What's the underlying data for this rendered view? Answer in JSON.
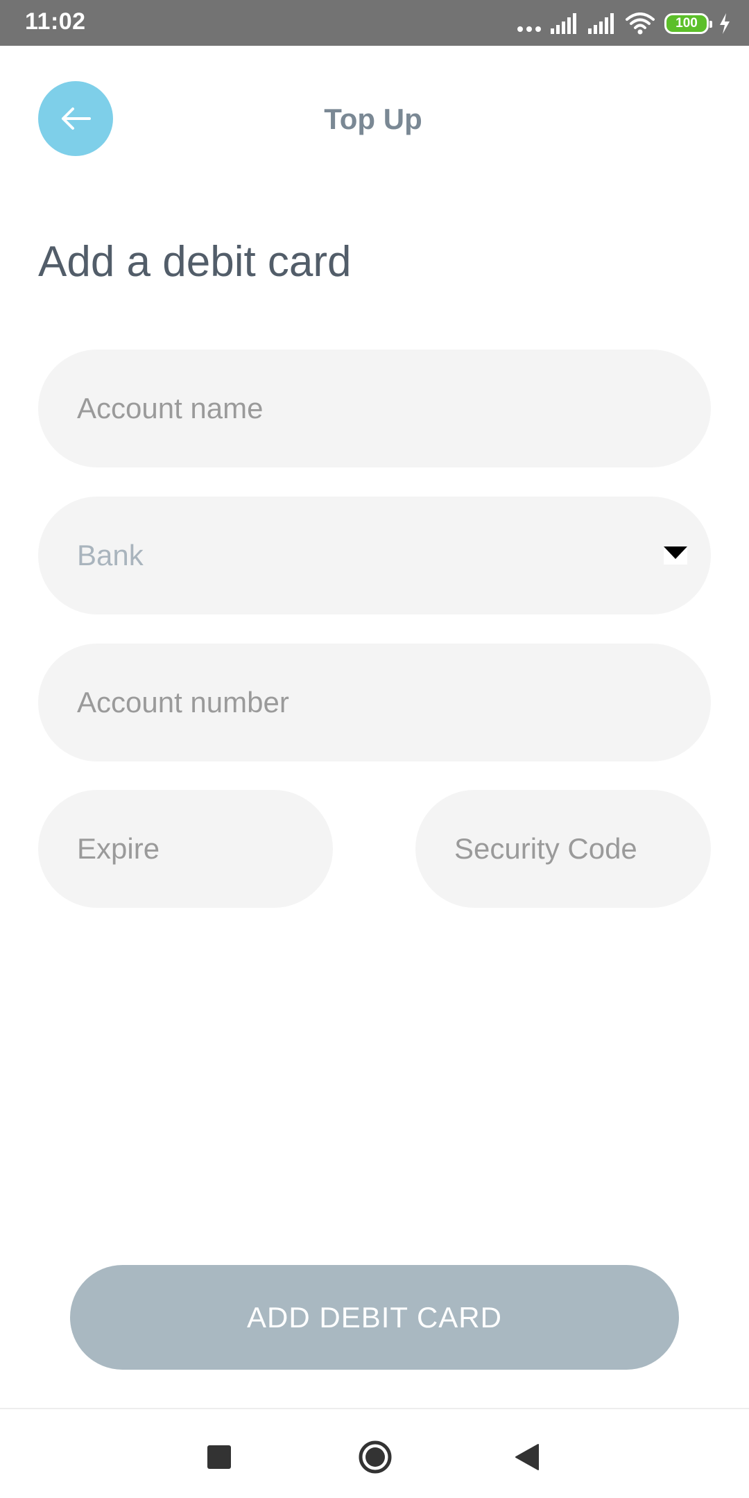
{
  "status_bar": {
    "time": "11:02",
    "battery": "100",
    "icons": [
      "more-dots-icon",
      "signal-icon",
      "signal-icon",
      "wifi-icon",
      "battery-icon",
      "charging-icon"
    ]
  },
  "header": {
    "title": "Top Up",
    "back_icon": "arrow-left-icon",
    "back_button_color": "#7ecfe9"
  },
  "page": {
    "heading": "Add a debit card"
  },
  "form": {
    "account_name_placeholder": "Account name",
    "bank_placeholder": "Bank",
    "account_number_placeholder": "Account number",
    "expire_placeholder": "Expire",
    "security_code_placeholder": "Security Code"
  },
  "submit": {
    "label": "ADD DEBIT CARD",
    "color": "#a9b8c1"
  },
  "nav": {
    "recents_icon": "square-icon",
    "home_icon": "circle-icon",
    "back_icon": "triangle-back-icon"
  }
}
